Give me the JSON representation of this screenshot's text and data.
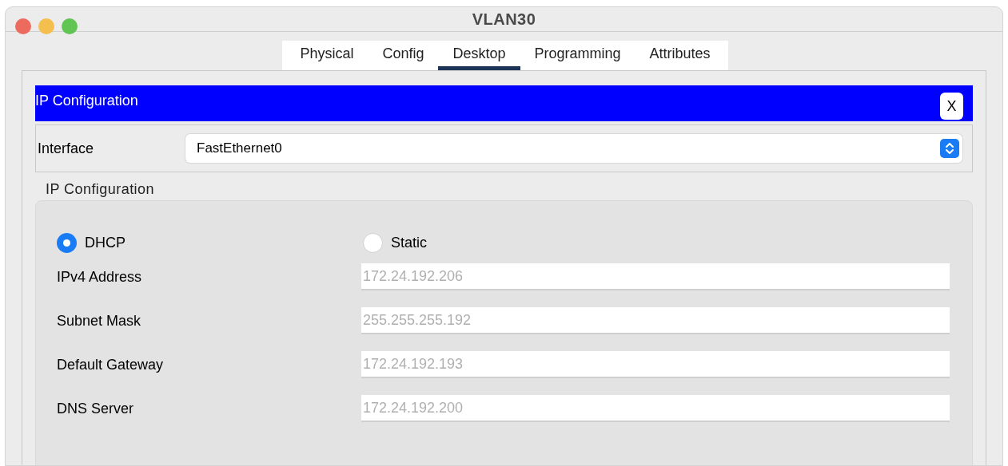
{
  "window": {
    "title": "VLAN30"
  },
  "tabs": [
    {
      "label": "Physical",
      "selected": false
    },
    {
      "label": "Config",
      "selected": false
    },
    {
      "label": "Desktop",
      "selected": true
    },
    {
      "label": "Programming",
      "selected": false
    },
    {
      "label": "Attributes",
      "selected": false
    }
  ],
  "panel": {
    "title": "IP Configuration",
    "close": "X"
  },
  "interface": {
    "label": "Interface",
    "value": "FastEthernet0"
  },
  "group": {
    "title": "IP Configuration",
    "modes": [
      {
        "label": "DHCP",
        "selected": true
      },
      {
        "label": "Static",
        "selected": false
      }
    ],
    "fields": [
      {
        "label": "IPv4 Address",
        "value": "172.24.192.206",
        "disabled": true
      },
      {
        "label": "Subnet Mask",
        "value": "255.255.255.192",
        "disabled": true
      },
      {
        "label": "Default Gateway",
        "value": "172.24.192.193",
        "disabled": true
      },
      {
        "label": "DNS Server",
        "value": "172.24.192.200",
        "disabled": true
      }
    ]
  }
}
